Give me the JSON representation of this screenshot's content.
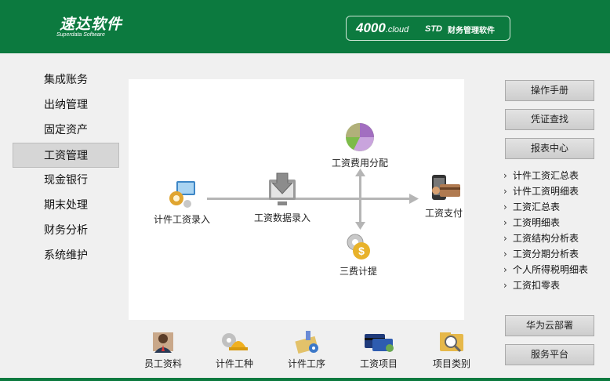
{
  "header": {
    "logo_cn": "速达软件",
    "logo_en": "Superdata Software",
    "product_main": "4000",
    "product_cloud": ".cloud",
    "product_std": "STD",
    "product_desc": "财务管理软件",
    "bg_color": "#0c7a3f"
  },
  "nav": {
    "items": [
      {
        "label": "集成账务"
      },
      {
        "label": "出纳管理"
      },
      {
        "label": "固定资产"
      },
      {
        "label": "工资管理"
      },
      {
        "label": "现金银行"
      },
      {
        "label": "期末处理"
      },
      {
        "label": "财务分析"
      },
      {
        "label": "系统维护"
      }
    ],
    "active": "工资管理"
  },
  "flow": {
    "nodes": [
      {
        "label": "计件工资录入",
        "icon": "gear-computer-icon"
      },
      {
        "label": "工资数据录入",
        "icon": "download-monitor-icon"
      },
      {
        "label": "工资费用分配",
        "icon": "pie-chart-icon"
      },
      {
        "label": "工资支付",
        "icon": "phone-card-icon"
      },
      {
        "label": "三费计提",
        "icon": "coin-gear-icon"
      }
    ]
  },
  "bottom_icons": [
    {
      "label": "员工资料",
      "icon": "employee-icon"
    },
    {
      "label": "计件工种",
      "icon": "worker-helmet-icon"
    },
    {
      "label": "计件工序",
      "icon": "process-flask-icon"
    },
    {
      "label": "工资项目",
      "icon": "cards-icon"
    },
    {
      "label": "项目类别",
      "icon": "magnifier-folder-icon"
    }
  ],
  "right": {
    "buttons": {
      "manual": "操作手册",
      "voucher_search": "凭证查找",
      "report_center": "报表中心",
      "huawei_cloud": "华为云部署",
      "service": "服务平台"
    },
    "reports": [
      {
        "label": "计件工资汇总表"
      },
      {
        "label": "计件工资明细表"
      },
      {
        "label": "工资汇总表"
      },
      {
        "label": "工资明细表"
      },
      {
        "label": "工资结构分析表"
      },
      {
        "label": "工资分期分析表"
      },
      {
        "label": "个人所得税明细表"
      },
      {
        "label": "工资扣零表"
      }
    ]
  }
}
